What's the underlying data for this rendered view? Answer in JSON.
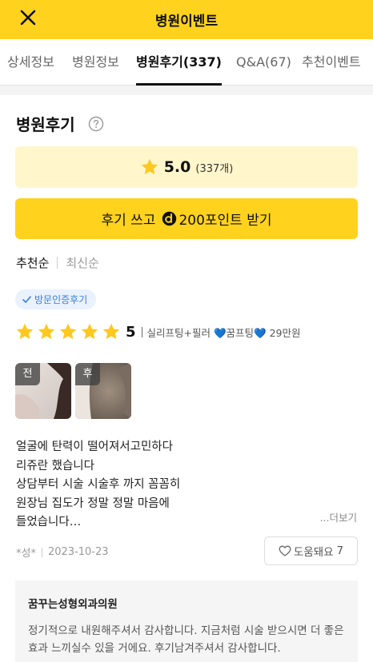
{
  "header": {
    "title": "병원이벤트",
    "close_icon": "close-icon",
    "background": "#FFD21E"
  },
  "tabs": [
    {
      "label": "상세정보",
      "active": false
    },
    {
      "label": "병원정보",
      "active": false
    },
    {
      "label": "병원후기(337)",
      "active": true
    },
    {
      "label": "Q&A(67)",
      "active": false
    },
    {
      "label": "추천이벤트",
      "active": false
    }
  ],
  "reviews_section": {
    "title": "병원후기",
    "help_icon": "question-circle-icon",
    "rating": {
      "score": "5.0",
      "count": "(337개)"
    },
    "write_button": {
      "label_prefix": "후기 쓰고",
      "label_suffix": "200포인트 받기",
      "point_icon": "point-d-icon"
    },
    "sort": {
      "options": [
        "추천순",
        "최신순"
      ],
      "selected": "추천순"
    }
  },
  "review": {
    "verified_badge": "방문인증후기",
    "stars": 5,
    "score": "5",
    "procedure_text": "실리프팅+필러 💙꿈프팅💙 29만원",
    "images": [
      {
        "label": "전"
      },
      {
        "label": "후"
      }
    ],
    "body": "얼굴에 탄력이 떨어져서고민하다\n리쥬란 했습니다\n상담부터 시술 시술후 까지 꼼꼼히\n원장님 집도가 정말 정말 마음에\n들었습니다…",
    "more_label": "...더보기",
    "author": "*성*",
    "date": "2023-10-23",
    "helpful_label": "도움돼요",
    "helpful_count": "7"
  },
  "reply": {
    "hospital_name": "꿈꾸는성형외과의원",
    "text": "정기적으로 내원해주셔서 감사합니다. 지금처럼 시술 받으시면 더 좋은 효과 느끼실수 있을 거에요. 후기남겨주셔서 감사합니다."
  },
  "colors": {
    "accent_yellow": "#FFD21E",
    "rating_bg": "#FFF6CC",
    "star": "#FFC81E",
    "verified_blue": "#3B7DDD"
  }
}
